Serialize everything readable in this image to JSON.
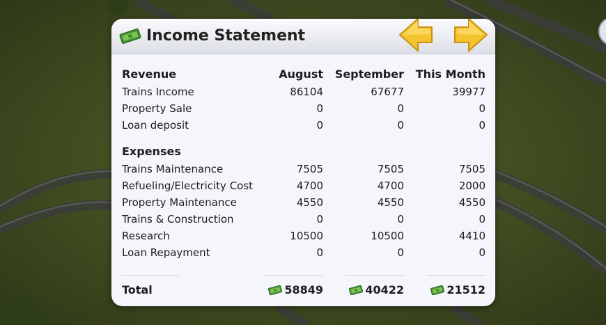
{
  "window": {
    "title": "Income Statement"
  },
  "icons": {
    "title": "money-icon",
    "prev": "arrow-left-icon",
    "next": "arrow-right-icon",
    "total": "money-icon"
  },
  "colors": {
    "arrow": "#f4c430",
    "money": "#5aa63a"
  },
  "columns": {
    "label": "Revenue",
    "c1": "August",
    "c2": "September",
    "c3": "This Month"
  },
  "revenue": [
    {
      "label": "Trains Income",
      "c1": "86104",
      "c2": "67677",
      "c3": "39977"
    },
    {
      "label": "Property Sale",
      "c1": "0",
      "c2": "0",
      "c3": "0"
    },
    {
      "label": "Loan deposit",
      "c1": "0",
      "c2": "0",
      "c3": "0"
    }
  ],
  "expenses_title": "Expenses",
  "expenses": [
    {
      "label": "Trains Maintenance",
      "c1": "7505",
      "c2": "7505",
      "c3": "7505"
    },
    {
      "label": "Refueling/Electricity Cost",
      "c1": "4700",
      "c2": "4700",
      "c3": "2000"
    },
    {
      "label": "Property Maintenance",
      "c1": "4550",
      "c2": "4550",
      "c3": "4550"
    },
    {
      "label": "Trains & Construction",
      "c1": "0",
      "c2": "0",
      "c3": "0"
    },
    {
      "label": "Research",
      "c1": "10500",
      "c2": "10500",
      "c3": "4410"
    },
    {
      "label": "Loan Repayment",
      "c1": "0",
      "c2": "0",
      "c3": "0"
    }
  ],
  "total": {
    "label": "Total",
    "c1": "58849",
    "c2": "40422",
    "c3": "21512"
  }
}
